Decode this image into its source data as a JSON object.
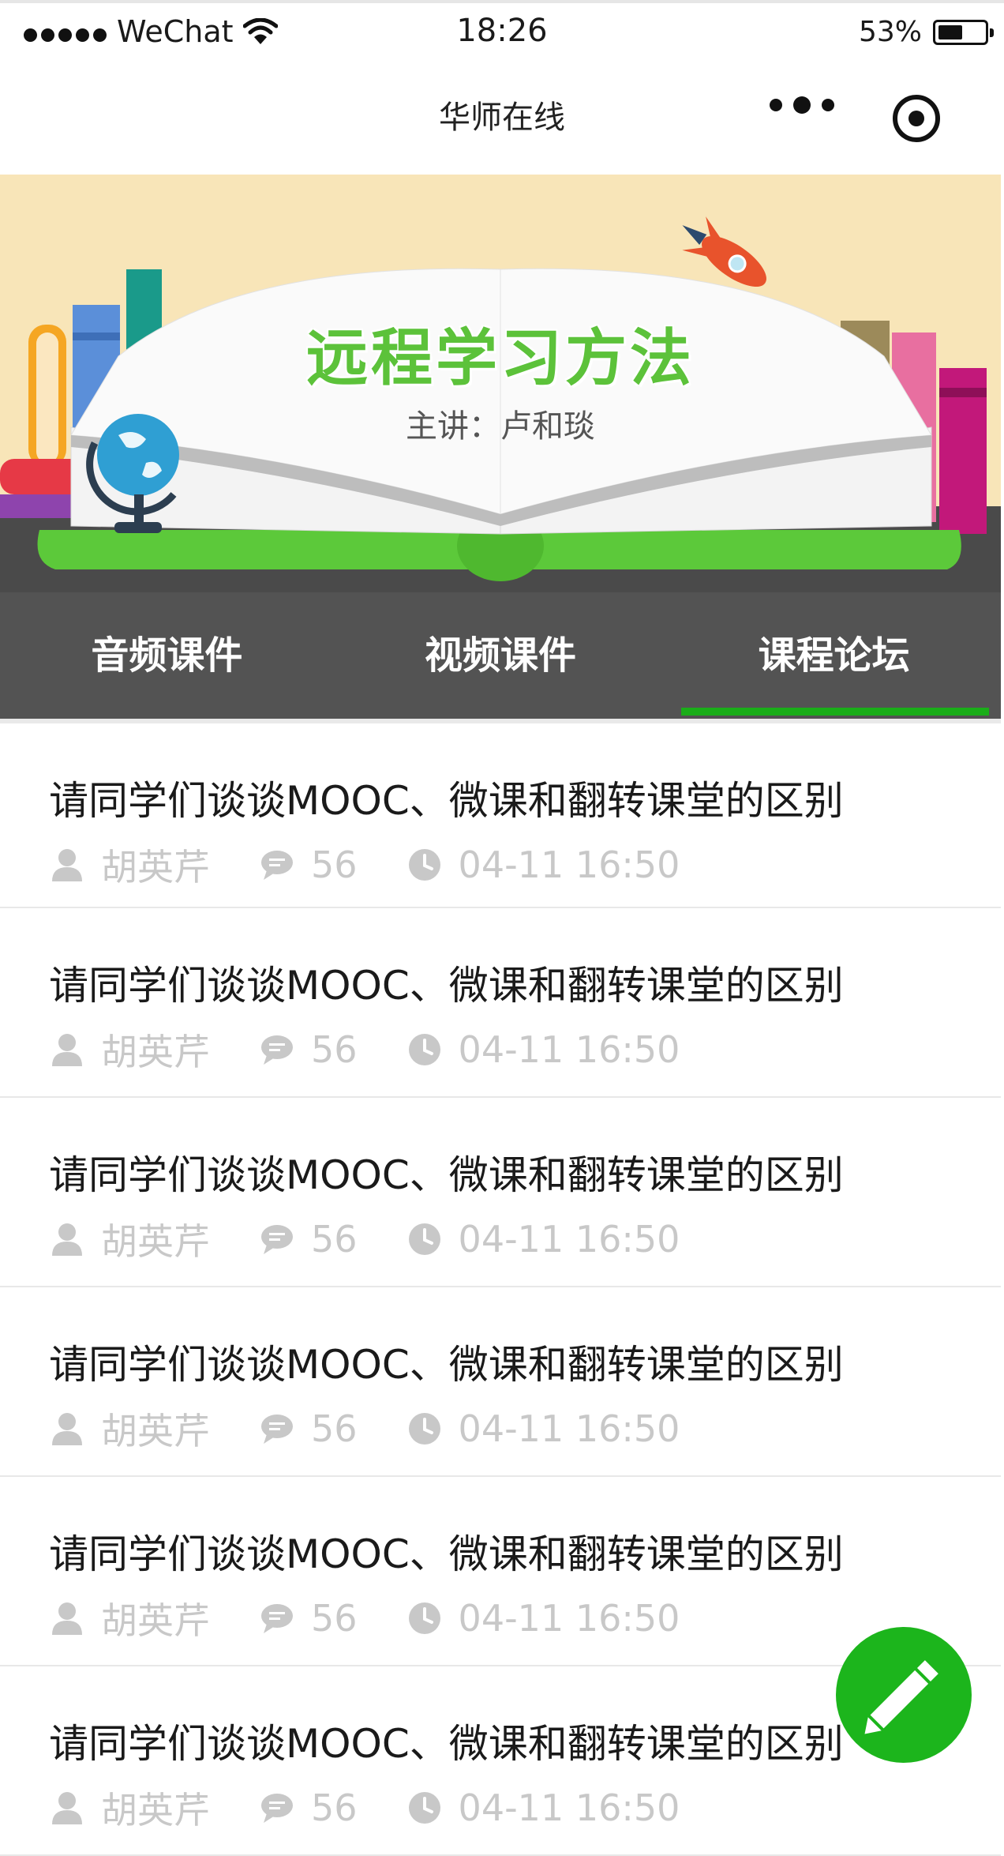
{
  "status_bar": {
    "carrier": "WeChat",
    "time": "18:26",
    "battery": "53%",
    "battery_level": 0.53
  },
  "nav": {
    "title": "华师在线"
  },
  "banner": {
    "title": "远程学习方法",
    "subtitle": "主讲：卢和琰"
  },
  "tabs": [
    {
      "label": "音频课件",
      "active": false
    },
    {
      "label": "视频课件",
      "active": false
    },
    {
      "label": "课程论坛",
      "active": true
    }
  ],
  "posts": [
    {
      "title": "请同学们谈谈MOOC、微课和翻转课堂的区别",
      "author": "胡英芹",
      "comments": "56",
      "time": "04-11 16:50"
    },
    {
      "title": "请同学们谈谈MOOC、微课和翻转课堂的区别",
      "author": "胡英芹",
      "comments": "56",
      "time": "04-11 16:50"
    },
    {
      "title": "请同学们谈谈MOOC、微课和翻转课堂的区别",
      "author": "胡英芹",
      "comments": "56",
      "time": "04-11 16:50"
    },
    {
      "title": "请同学们谈谈MOOC、微课和翻转课堂的区别",
      "author": "胡英芹",
      "comments": "56",
      "time": "04-11 16:50"
    },
    {
      "title": "请同学们谈谈MOOC、微课和翻转课堂的区别",
      "author": "胡英芹",
      "comments": "56",
      "time": "04-11 16:50"
    },
    {
      "title": "请同学们谈谈MOOC、微课和翻转课堂的区别",
      "author": "胡英芹",
      "comments": "56",
      "time": "04-11 16:50"
    }
  ],
  "icons": {
    "author": "person-icon",
    "comments": "comment-bubble-icon",
    "time": "clock-icon",
    "fab": "pencil-icon"
  },
  "colors": {
    "accent": "#1aad19",
    "tab_bar": "#535353",
    "meta_text": "#c8c8c8",
    "banner_bg": "#f8e5b8",
    "banner_title": "#5cc23a"
  }
}
